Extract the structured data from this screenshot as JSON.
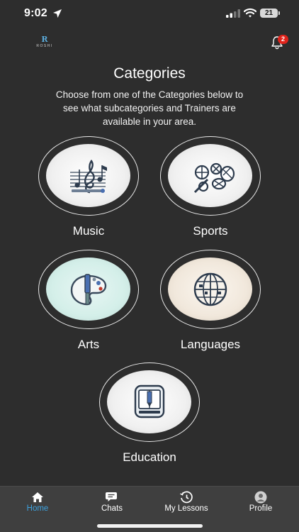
{
  "status_bar": {
    "time": "9:02",
    "battery": "21"
  },
  "header": {
    "logo_mark": "R",
    "logo_text": "ROSHI",
    "notification_count": "2"
  },
  "page": {
    "title": "Categories",
    "subtitle": "Choose from one of the Categories below to see what subcategories and Trainers are available in your area."
  },
  "categories": [
    {
      "label": "Music",
      "icon": "music-notes-icon"
    },
    {
      "label": "Sports",
      "icon": "sports-balls-icon"
    },
    {
      "label": "Arts",
      "icon": "palette-brush-icon"
    },
    {
      "label": "Languages",
      "icon": "globe-icon"
    },
    {
      "label": "Education",
      "icon": "book-pencil-icon"
    }
  ],
  "tabbar": {
    "active": "Home",
    "items": [
      {
        "label": "Home",
        "icon": "home-icon"
      },
      {
        "label": "Chats",
        "icon": "chat-bubbles-icon"
      },
      {
        "label": "My Lessons",
        "icon": "history-icon"
      },
      {
        "label": "Profile",
        "icon": "profile-icon"
      }
    ]
  },
  "colors": {
    "background": "#2d2d2d",
    "accent": "#3ea3e0",
    "badge": "#e0231b",
    "tabbar": "#3f3f3f"
  }
}
